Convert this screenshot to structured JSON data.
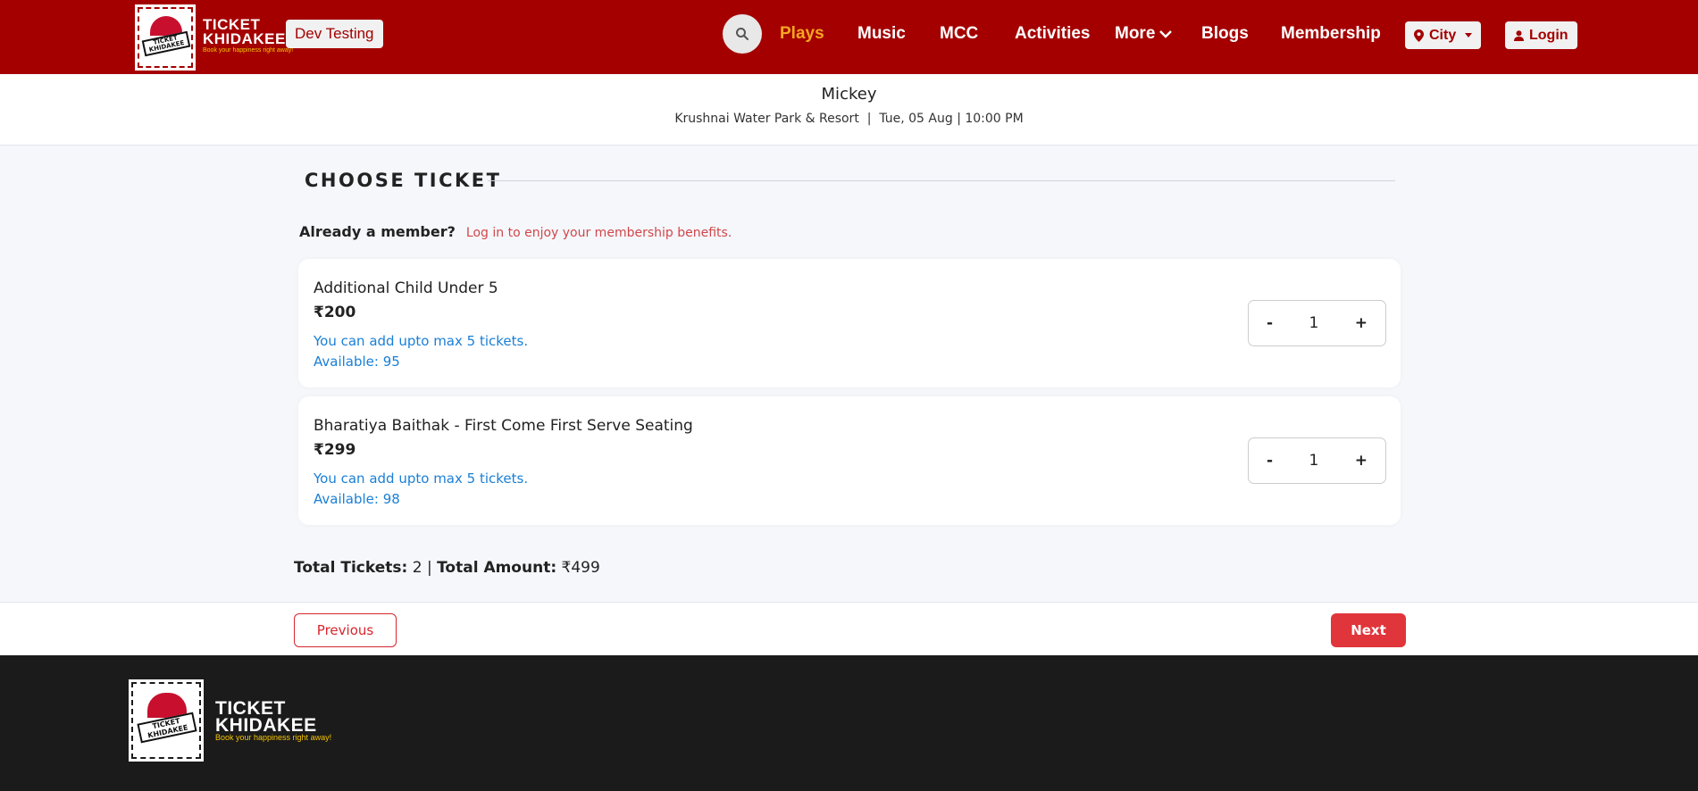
{
  "header": {
    "logo": {
      "line1": "TICKET",
      "line2": "KHIDAKEE",
      "tagline": "Book your happiness right away!",
      "badge_text": "TICKET KHIDAKEE"
    },
    "env_badge": "Dev Testing",
    "nav": [
      "Plays",
      "Music",
      "MCC",
      "Activities",
      "More",
      "Blogs",
      "Membership"
    ],
    "active_nav": "Plays",
    "city_label": "City",
    "login_label": "Login",
    "colors": {
      "brand": "#a40000",
      "active": "#f5a623"
    }
  },
  "event": {
    "title": "Mickey",
    "subtitle": "Krushnai Water Park & Resort  |  Tue, 05 Aug | 10:00 PM"
  },
  "section": {
    "title": "CHOOSE TICKET",
    "member_question": "Already a member?",
    "member_link": "Log in to enjoy your membership benefits."
  },
  "tickets": [
    {
      "name": "Additional Child Under 5",
      "price": "₹200",
      "max_note": "You can add upto max 5 tickets.",
      "available": "Available: 95",
      "qty": "1"
    },
    {
      "name": "Bharatiya Baithak - First Come First Serve Seating",
      "price": "₹299",
      "max_note": "You can add upto max 5 tickets.",
      "available": "Available: 98",
      "qty": "1"
    }
  ],
  "stepper": {
    "minus": "-",
    "plus": "+"
  },
  "totals": {
    "tickets_label": "Total Tickets:",
    "tickets_value": "2",
    "separator": "|",
    "amount_label": "Total Amount:",
    "amount_value": "₹499"
  },
  "actions": {
    "previous": "Previous",
    "next": "Next"
  },
  "footer": {
    "logo": {
      "line1": "TICKET",
      "line2": "KHIDAKEE",
      "tagline": "Book your happiness right away!",
      "badge_text": "TICKET KHIDAKEE"
    }
  }
}
